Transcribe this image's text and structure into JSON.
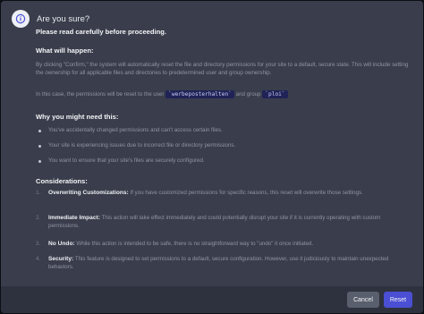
{
  "dialog": {
    "title": "Are you sure?",
    "intro": "Please read carefully before proceeding.",
    "what": {
      "heading": "What will happen:",
      "p1": "By clicking \"Confirm,\" the system will automatically reset the file and directory permissions for your site to a default, secure state. This will include setting the ownership for all applicable files and directories to predetermined user and group ownership.",
      "p2_before": "In this case, the permissions will be reset to the user",
      "user": "`werbeposterhalten`",
      "p2_middle": "and group",
      "group": "`ploi`"
    },
    "why": {
      "heading": "Why you might need this:",
      "items": [
        "You've accidentally changed permissions and can't access certain files.",
        "Your site is experiencing issues due to incorrect file or directory permissions.",
        "You want to ensure that your site's files are securely configured."
      ]
    },
    "considerations": {
      "heading": "Considerations:",
      "items": [
        {
          "num": "1.",
          "label": "Overwriting Customizations:",
          "text": "If you have customized permissions for specific reasons, this reset will overwrite those settings."
        },
        {
          "num": "2.",
          "label": "Immediate Impact:",
          "text": "This action will take effect immediately and could potentially disrupt your site if it is currently operating with custom permissions."
        },
        {
          "num": "3.",
          "label": "No Undo:",
          "text": "While this action is intended to be safe, there is no straightforward way to \"undo\" it once initiated."
        },
        {
          "num": "4.",
          "label": "Security:",
          "text": "This feature is designed to set permissions to a default, secure configuration. However, use it judiciously to maintain unexpected behaviors."
        }
      ]
    }
  },
  "footer": {
    "cancel_label": "Cancel",
    "reset_label": "Reset"
  },
  "colors": {
    "accent": "#4a4fd3",
    "dialog_bg": "#3a3e4c",
    "footer_bg": "#2e323e"
  }
}
